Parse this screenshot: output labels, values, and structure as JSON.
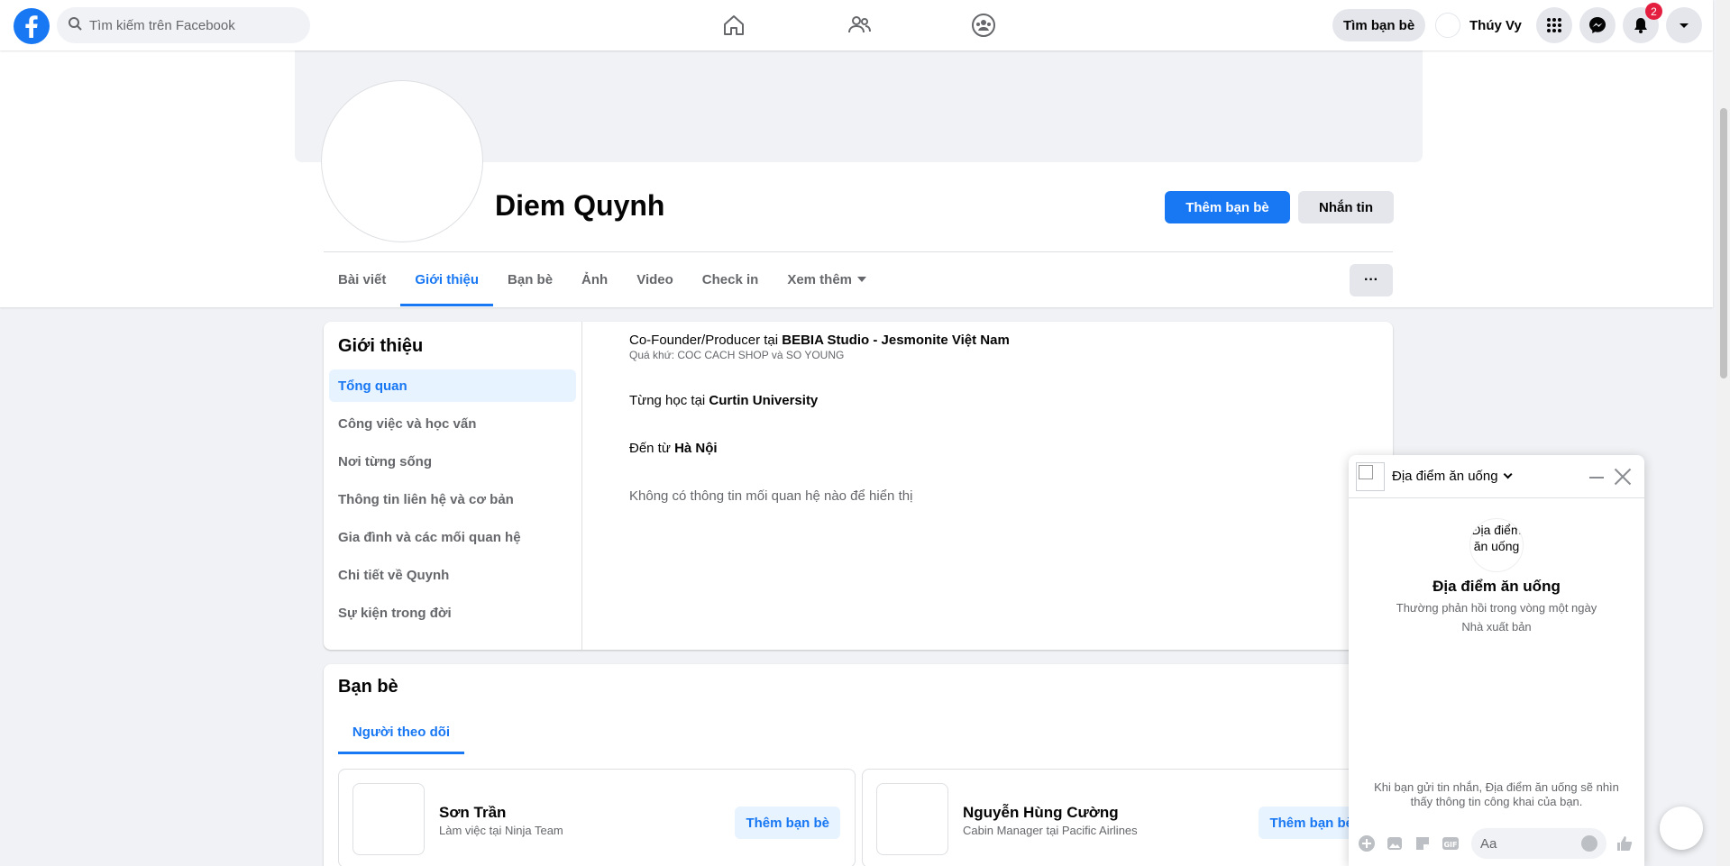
{
  "topbar": {
    "search_placeholder": "Tìm kiếm trên Facebook",
    "find_friends": "Tìm bạn bè",
    "user_name": "Thúy Vy",
    "notification_count": "2"
  },
  "profile": {
    "name": "Diem Quynh",
    "add_friend": "Thêm bạn bè",
    "message": "Nhắn tin",
    "more_label": "···",
    "tabs": [
      "Bài viết",
      "Giới thiệu",
      "Bạn bè",
      "Ảnh",
      "Video",
      "Check in",
      "Xem thêm"
    ]
  },
  "about": {
    "title": "Giới thiệu",
    "menu": [
      "Tổng quan",
      "Công việc và học vấn",
      "Nơi từng sống",
      "Thông tin liên hệ và cơ bản",
      "Gia đình và các mối quan hệ",
      "Chi tiết về Quynh",
      "Sự kiện trong đời"
    ],
    "work_prefix": "Co-Founder/Producer tại ",
    "work_place": "BEBIA Studio - Jesmonite Việt Nam",
    "work_past": "Quá khứ: COC CACH SHOP và SO YOUNG",
    "edu_prefix": "Từng học tại ",
    "edu_place": "Curtin University",
    "from_prefix": "Đến từ ",
    "from_place": "Hà Nội",
    "relationship": "Không có thông tin mối quan hệ nào để hiển thị"
  },
  "friends": {
    "title": "Bạn bè",
    "tab": "Người theo dõi",
    "list": [
      {
        "name": "Sơn Trần",
        "desc": "Làm việc tại Ninja Team",
        "action": "Thêm bạn bè"
      },
      {
        "name": "Nguyễn Hùng Cường",
        "desc": "Cabin Manager tại Pacific Airlines",
        "action": "Thêm bạn bè"
      }
    ]
  },
  "chat": {
    "title": "Địa điểm ăn uống",
    "avatar_alt": "Địa điểm ăn uống",
    "name": "Địa điểm ăn uống",
    "response": "Thường phản hồi trong vòng một ngày",
    "role": "Nhà xuất bản",
    "note": "Khi bạn gửi tin nhắn, Địa điểm ăn uống sẽ nhìn thấy thông tin công khai của bạn.",
    "input_placeholder": "Aa"
  },
  "colors": {
    "accent": "#1877f2",
    "badge": "#e41e3f"
  },
  "icons": [
    "facebook-logo-icon",
    "search-icon",
    "home-icon",
    "friends-icon",
    "groups-icon",
    "menu-grid-icon",
    "messenger-icon",
    "bell-icon",
    "caret-down-icon",
    "plus-icon",
    "image-icon",
    "sticker-icon",
    "gif-icon",
    "emoji-icon",
    "like-icon"
  ]
}
